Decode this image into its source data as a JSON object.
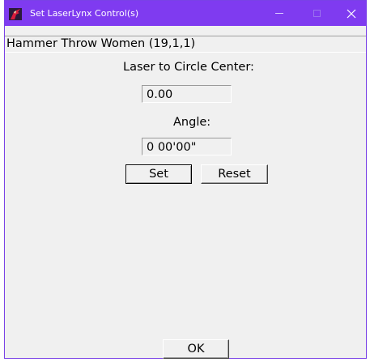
{
  "window": {
    "title": "Set LaserLynx Control(s)",
    "app_icon": "laserlynx-app-icon",
    "controls": {
      "minimize": "minimize-icon",
      "maximize": "maximize-icon",
      "close": "close-icon"
    },
    "title_bar_color": "#7f3bf0"
  },
  "event": {
    "heading": "Hammer Throw Women (19,1,1)"
  },
  "distance": {
    "label": "Laser to Circle Center:",
    "value": "0.00"
  },
  "angle": {
    "label": "Angle:",
    "value": "0 00'00\""
  },
  "buttons": {
    "set": "Set",
    "reset": "Reset",
    "ok": "OK"
  }
}
